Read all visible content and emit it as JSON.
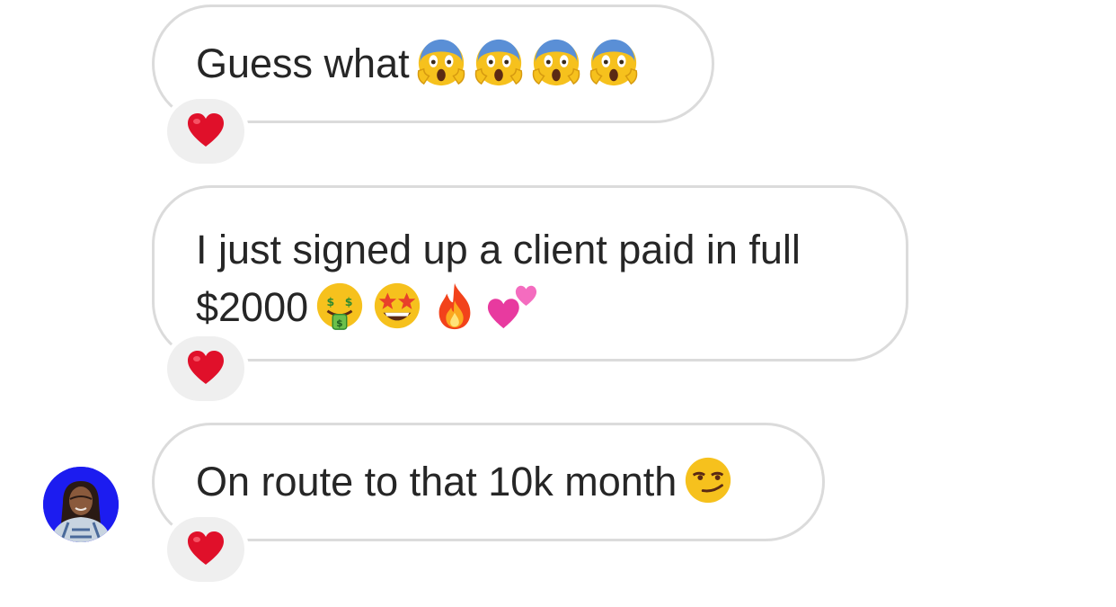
{
  "messages": [
    {
      "text": "Guess what",
      "emojis": [
        "face-screaming-in-fear-icon",
        "face-screaming-in-fear-icon",
        "face-screaming-in-fear-icon",
        "face-screaming-in-fear-icon"
      ],
      "reaction": "red-heart-icon"
    },
    {
      "text_line1": "I just signed up a client paid in full",
      "text_line2": "$2000",
      "emojis": [
        "money-mouth-face-icon",
        "star-struck-face-icon",
        "fire-icon",
        "two-hearts-icon"
      ],
      "reaction": "red-heart-icon"
    },
    {
      "text": "On route to that 10k month",
      "emojis": [
        "smirking-face-icon"
      ],
      "reaction": "red-heart-icon"
    }
  ],
  "sender": {
    "avatar": "avatar-photo",
    "avatar_bg": "#1c1cf0"
  },
  "colors": {
    "bubble_border": "#dbdbdb",
    "reaction_bg": "#efefef",
    "text": "#262626",
    "heart": "#e0102a"
  }
}
